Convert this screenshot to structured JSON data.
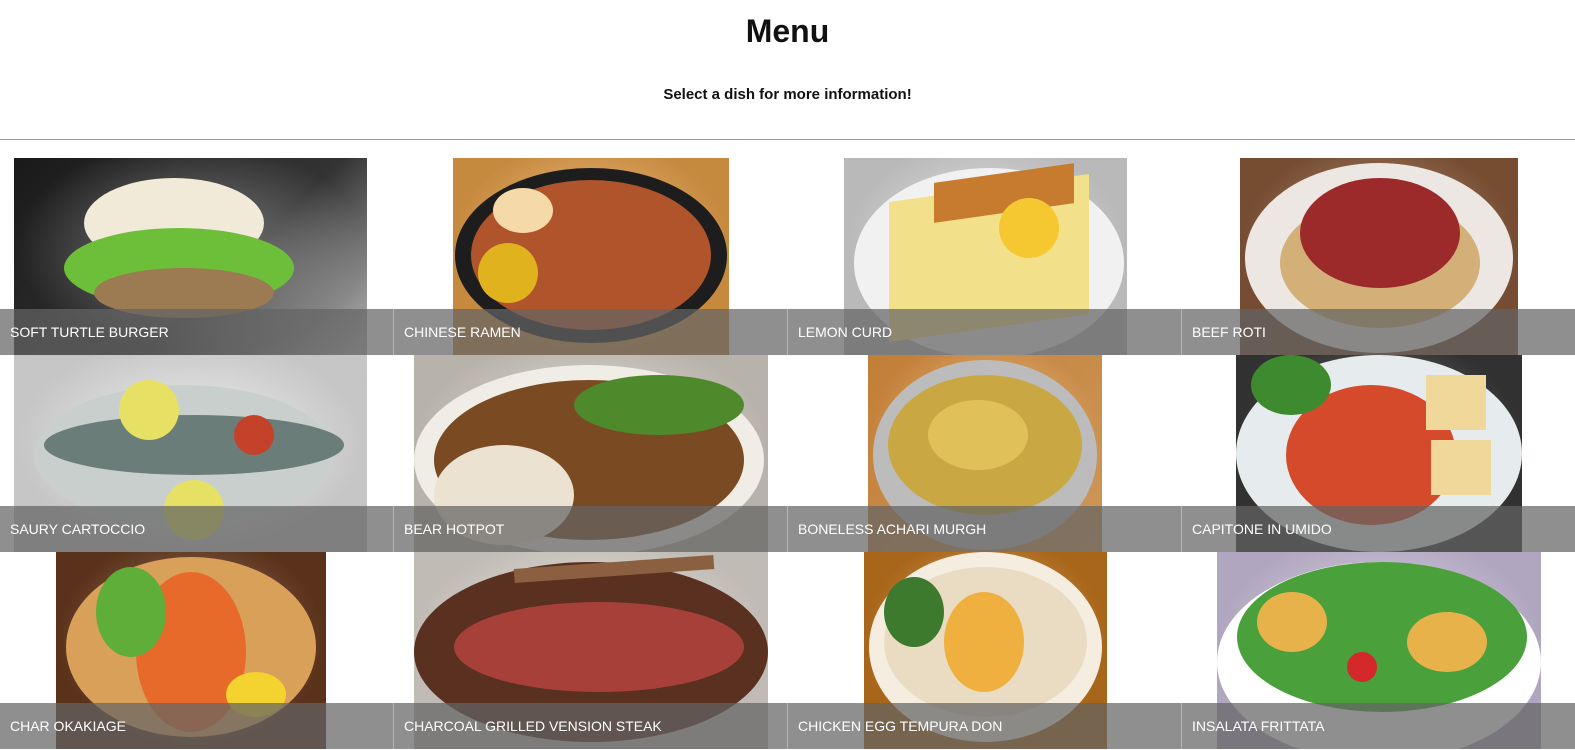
{
  "page": {
    "title": "Menu",
    "subtitle": "Select a dish for more information!"
  },
  "dishes": [
    {
      "name": "SOFT TURTLE BURGER",
      "icon": "burger-image",
      "colors": [
        "#2a2a2a",
        "#f2ead8",
        "#6dbf3a"
      ]
    },
    {
      "name": "CHINESE RAMEN",
      "icon": "ramen-image",
      "colors": [
        "#e9a24a",
        "#1d1d1d",
        "#b0542c"
      ]
    },
    {
      "name": "LEMON CURD",
      "icon": "lemon-curd-image",
      "colors": [
        "#d9d9d9",
        "#f3e08a",
        "#c77b2e"
      ]
    },
    {
      "name": "BEEF ROTI",
      "icon": "beef-roti-image",
      "colors": [
        "#8a5a3a",
        "#ece7e2",
        "#9c2a2a"
      ]
    },
    {
      "name": "SAURY CARTOCCIO",
      "icon": "saury-image",
      "colors": [
        "#e8e8e8",
        "#6b7d78",
        "#e6e064"
      ]
    },
    {
      "name": "BEAR HOTPOT",
      "icon": "hotpot-image",
      "colors": [
        "#d8d2c8",
        "#7a4a22",
        "#4e8a2c"
      ]
    },
    {
      "name": "BONELESS ACHARI MURGH",
      "icon": "murgh-image",
      "colors": [
        "#e49440",
        "#bcbcbc",
        "#c9a844"
      ]
    },
    {
      "name": "CAPITONE IN UMIDO",
      "icon": "capitone-image",
      "colors": [
        "#3a3a3a",
        "#e6ecee",
        "#d44a2a"
      ]
    },
    {
      "name": "CHAR OKAKIAGE",
      "icon": "okakiage-image",
      "colors": [
        "#6a3a1e",
        "#d9a05a",
        "#e86a2a"
      ]
    },
    {
      "name": "CHARCOAL GRILLED VENSION STEAK",
      "icon": "steak-image",
      "colors": [
        "#e2dcd4",
        "#5a3020",
        "#a8403a"
      ]
    },
    {
      "name": "CHICKEN EGG TEMPURA DON",
      "icon": "tempura-don-image",
      "colors": [
        "#c6781e",
        "#f4ede0",
        "#f0b040"
      ]
    },
    {
      "name": "INSALATA FRITTATA",
      "icon": "salad-image",
      "colors": [
        "#cfc3e0",
        "#ffffff",
        "#4aa03a"
      ]
    }
  ]
}
